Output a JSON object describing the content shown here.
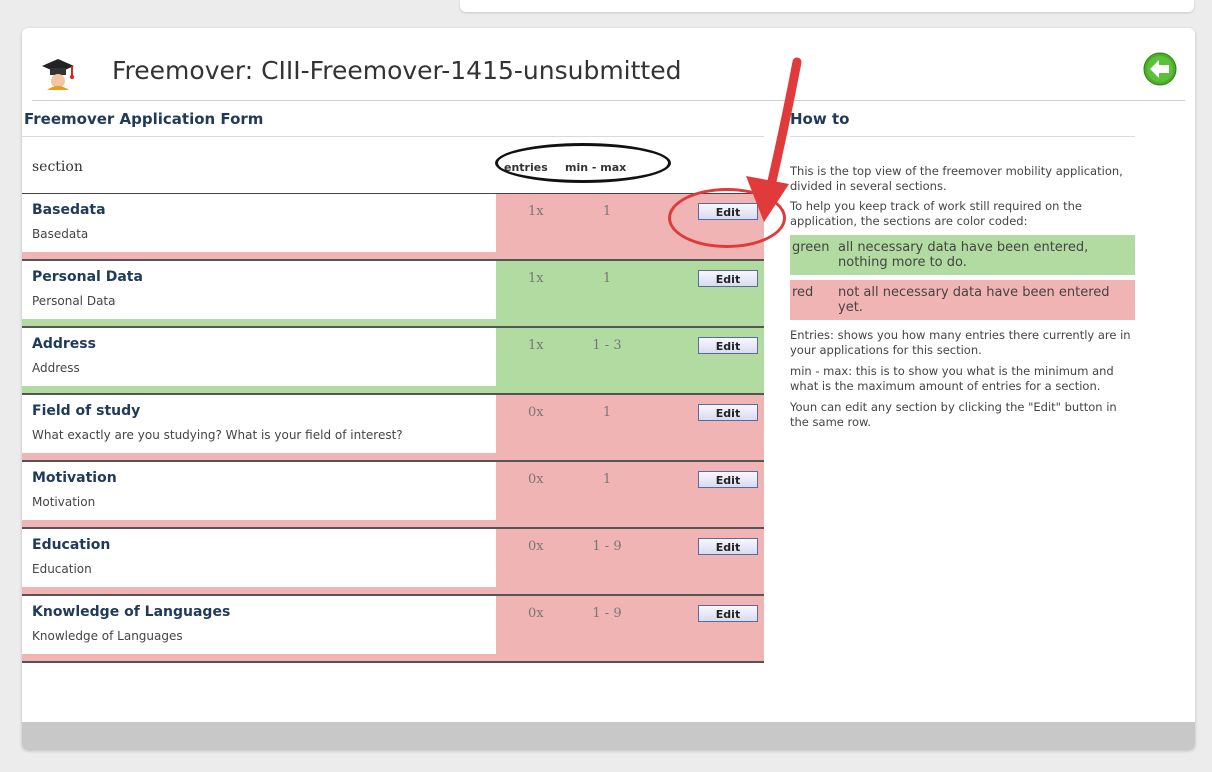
{
  "header": {
    "title": "Freemover: CIII-Freemover-1415-unsubmitted",
    "logo_icon": "graduation-cap-icon",
    "back_icon": "back-arrow-icon"
  },
  "form": {
    "title": "Freemover Application Form",
    "columns": {
      "section": "section",
      "entries": "entries",
      "minmax": "min - max"
    },
    "edit_label": "Edit",
    "rows": [
      {
        "name": "Basedata",
        "desc": "Basedata",
        "entries": "1x",
        "minmax": "1",
        "status": "red"
      },
      {
        "name": "Personal Data",
        "desc": "Personal Data",
        "entries": "1x",
        "minmax": "1",
        "status": "green"
      },
      {
        "name": "Address",
        "desc": "Address",
        "entries": "1x",
        "minmax": "1 - 3",
        "status": "green"
      },
      {
        "name": "Field of study",
        "desc": "What exactly are you studying? What is your field of interest?",
        "entries": "0x",
        "minmax": "1",
        "status": "red"
      },
      {
        "name": "Motivation",
        "desc": "Motivation",
        "entries": "0x",
        "minmax": "1",
        "status": "red"
      },
      {
        "name": "Education",
        "desc": "Education",
        "entries": "0x",
        "minmax": "1 - 9",
        "status": "red"
      },
      {
        "name": "Knowledge of Languages",
        "desc": "Knowledge of Languages",
        "entries": "0x",
        "minmax": "1 - 9",
        "status": "red"
      }
    ]
  },
  "howto": {
    "title": "How to",
    "p1": "This is the top view of the freemover mobility application, divided in several sections.",
    "p2": "To help you keep track of work still required on the application, the sections are color coded:",
    "green_key": "green",
    "green_text": "all necessary data have been entered, nothing more to do.",
    "red_key": "red",
    "red_text": "not all necessary data have been entered yet.",
    "p3": "Entries: shows you how many entries there currently are in your applications for this section.",
    "p4": "min - max: this is to show you what is the minimum and what is the maximum amount of entries for a section.",
    "p5": "Youn can edit any section by clicking the \"Edit\" button in the same row."
  },
  "colors": {
    "red_status": "#f1b4b4",
    "green_status": "#b2dba1",
    "annotation_arrow": "#e03a3a",
    "heading": "#1f3a5a"
  }
}
